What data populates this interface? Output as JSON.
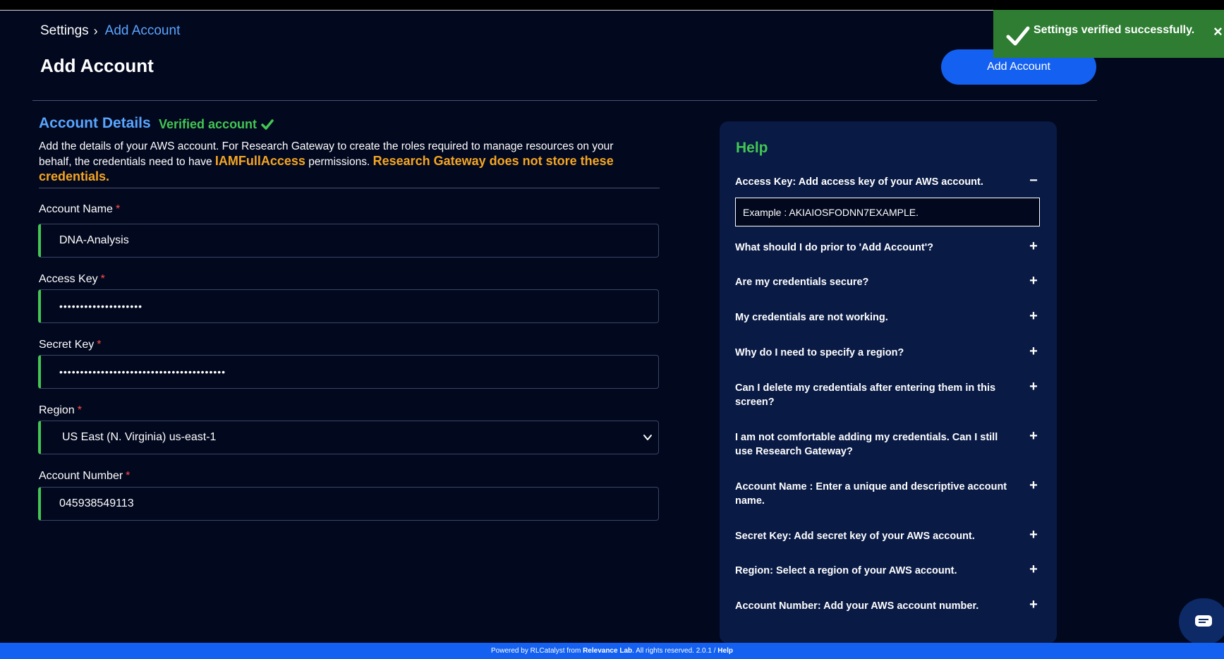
{
  "breadcrumb": {
    "root": "Settings",
    "separator": "›",
    "current": "Add Account"
  },
  "page": {
    "title": "Add Account",
    "add_button_label": "Add Account"
  },
  "toast": {
    "message": "Settings verified successfully.",
    "close_label": "×",
    "icon": "check-icon",
    "color": "#2e7d32"
  },
  "form": {
    "section_title": "Account Details",
    "verified_label": "Verified account",
    "intro_part1": "Add the details of your AWS account. For Research Gateway to create the roles required to manage resources on your behalf, the credentials need to have ",
    "intro_highlight1": "IAMFullAccess",
    "intro_part2": " permissions. ",
    "intro_highlight2": "Research Gateway does not store these credentials.",
    "required_marker": "*",
    "fields": {
      "account_name": {
        "label": "Account Name",
        "value": "DNA-Analysis"
      },
      "access_key": {
        "label": "Access Key",
        "value": "••••••••••••••••••••"
      },
      "secret_key": {
        "label": "Secret Key",
        "value": "••••••••••••••••••••••••••••••••••••••••"
      },
      "region": {
        "label": "Region",
        "value": "US East (N. Virginia) us-east-1"
      },
      "account_number": {
        "label": "Account Number",
        "value": "045938549113"
      }
    }
  },
  "help": {
    "title": "Help",
    "expanded_answer": "Example : AKIAIOSFODNN7EXAMPLE.",
    "items": [
      {
        "question": "Access Key: Add access key of your AWS account.",
        "toggle": "−"
      },
      {
        "question": "What should I do prior to 'Add Account'?",
        "toggle": "+"
      },
      {
        "question": "Are my credentials secure?",
        "toggle": "+"
      },
      {
        "question": "My credentials are not working.",
        "toggle": "+"
      },
      {
        "question": "Why do I need to specify a region?",
        "toggle": "+"
      },
      {
        "question": "Can I delete my credentials after entering them in this screen?",
        "toggle": "+"
      },
      {
        "question": "I am not comfortable adding my credentials. Can I still use Research Gateway?",
        "toggle": "+"
      },
      {
        "question": "Account Name : Enter a unique and descriptive account name.",
        "toggle": "+"
      },
      {
        "question": "Secret Key: Add secret key of your AWS account.",
        "toggle": "+"
      },
      {
        "question": "Region: Select a region of your AWS account.",
        "toggle": "+"
      },
      {
        "question": "Account Number: Add your AWS account number.",
        "toggle": "+"
      }
    ]
  },
  "footer": {
    "prefix": "Powered by RLCatalyst from ",
    "company": "Relevance Lab",
    "suffix": ". All rights reserved. 2.0.1 / ",
    "help_link": "Help"
  },
  "colors": {
    "background": "#02081e",
    "accent_blue": "#1460f0",
    "link_blue": "#5aa5ff",
    "success_green": "#43c653",
    "highlight_orange": "#f5a623",
    "help_panel": "#091a45"
  }
}
